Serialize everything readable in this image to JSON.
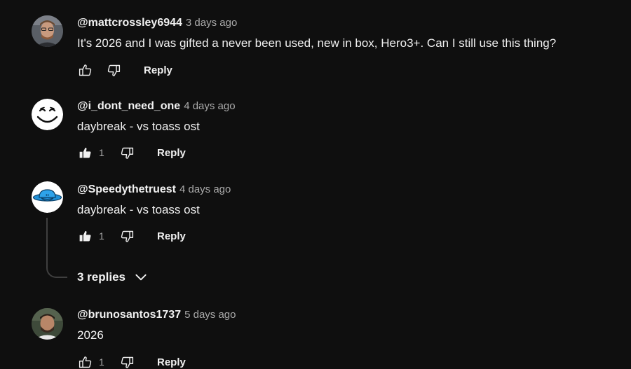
{
  "comments": [
    {
      "author": "@mattcrossley6944",
      "time": "3 days ago",
      "text": "It's 2026 and I was gifted a never been used, new in box, Hero3+. Can I still use this thing?",
      "likes": "",
      "liked": false,
      "reply_label": "Reply"
    },
    {
      "author": "@i_dont_need_one",
      "time": "4 days ago",
      "text": "daybreak - vs toass ost",
      "likes": "1",
      "liked": true,
      "reply_label": "Reply"
    },
    {
      "author": "@Speedythetruest",
      "time": "4 days ago",
      "text": "daybreak - vs toass ost",
      "likes": "1",
      "liked": true,
      "reply_label": "Reply",
      "replies_label": "3 replies"
    },
    {
      "author": "@brunosantos1737",
      "time": "5 days ago",
      "text": "2026",
      "likes": "1",
      "liked": false,
      "reply_label": "Reply"
    }
  ],
  "icons": {
    "like": "thumbs-up-icon",
    "like_filled": "thumbs-up-filled-icon",
    "dislike": "thumbs-down-icon",
    "expand": "chevron-down-icon"
  },
  "colors": {
    "background": "#0f0f0f",
    "text": "#f1f1f1",
    "secondary_text": "#aaaaaa"
  }
}
